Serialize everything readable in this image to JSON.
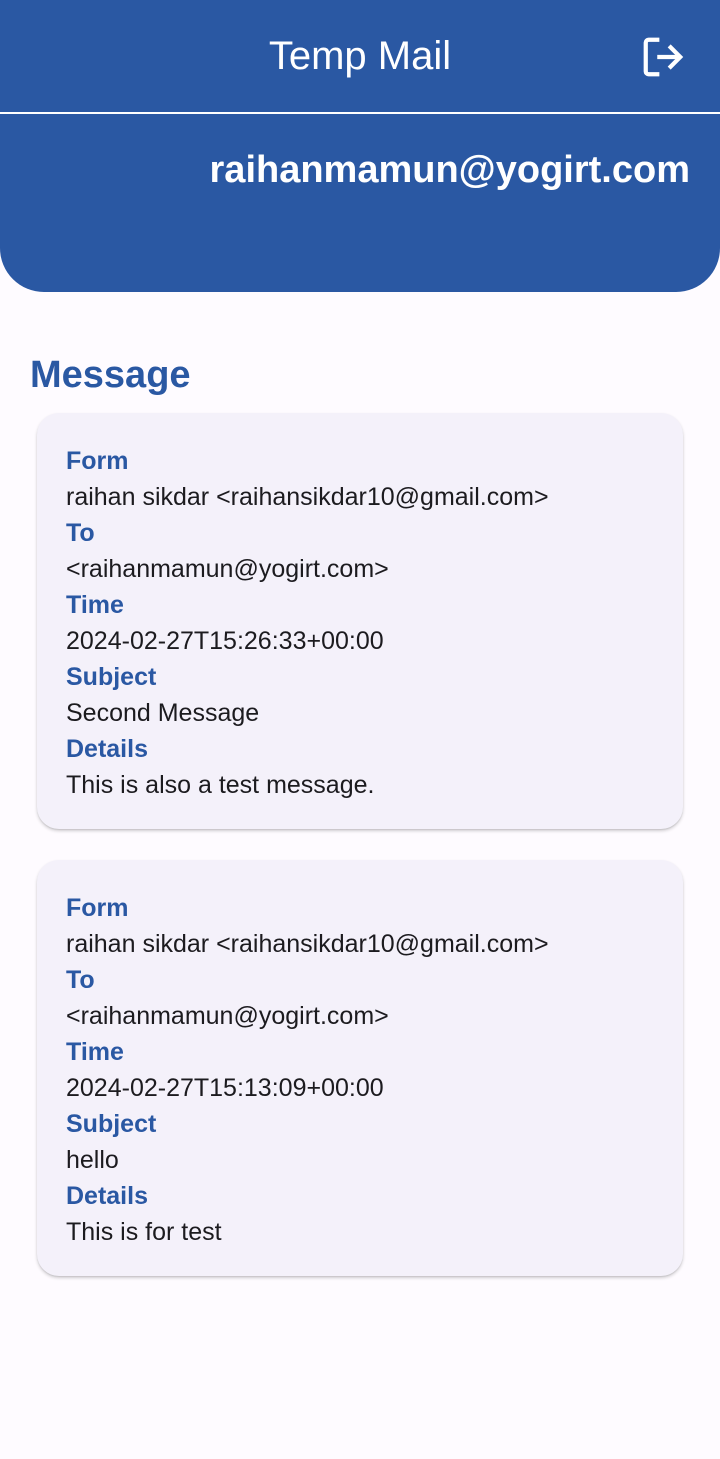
{
  "app": {
    "title": "Temp Mail",
    "logout_icon": "logout-icon",
    "current_email": "raihanmamun@yogirt.com"
  },
  "colors": {
    "primary": "#2a58a3",
    "background": "#fefbff",
    "card": "#f4f1fa",
    "text": "#1c1b1f"
  },
  "section": {
    "title": "Message"
  },
  "labels": {
    "from": "Form",
    "to": "To",
    "time": "Time",
    "subject": "Subject",
    "details": "Details"
  },
  "messages": [
    {
      "from": "raihan sikdar <raihansikdar10@gmail.com>",
      "to": "<raihanmamun@yogirt.com>",
      "time": "2024-02-27T15:26:33+00:00",
      "subject": "Second Message",
      "details": "This is also a test message."
    },
    {
      "from": "raihan sikdar <raihansikdar10@gmail.com>",
      "to": "<raihanmamun@yogirt.com>",
      "time": "2024-02-27T15:13:09+00:00",
      "subject": "hello",
      "details": "This is for test"
    }
  ]
}
